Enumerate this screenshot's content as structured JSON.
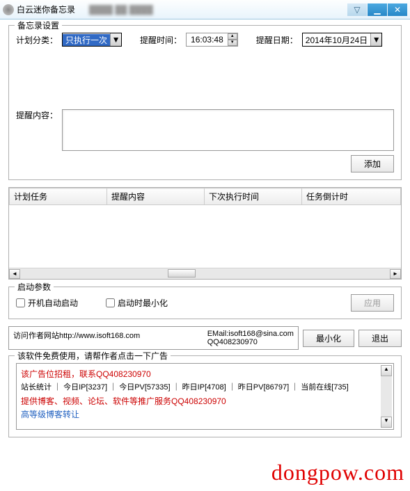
{
  "titlebar": {
    "title": "白云迷你备忘录"
  },
  "settings": {
    "legend": "备忘录设置",
    "plan_type_label": "计划分类：",
    "plan_type_value": "只执行一次",
    "reminder_time_label": "提醒时间：",
    "reminder_time_value": "16:03:48",
    "reminder_date_label": "提醒日期：",
    "reminder_date_value": "2014年10月24日",
    "content_label": "提醒内容：",
    "add_button": "添加"
  },
  "table": {
    "columns": [
      "计划任务",
      "提醒内容",
      "下次执行时间",
      "任务倒计时"
    ]
  },
  "startup": {
    "legend": "启动参数",
    "auto_start": "开机自动启动",
    "minimize_on_start": "启动时最小化",
    "apply": "应用"
  },
  "footer": {
    "link_text": "访问作者网站http://www.isoft168.com",
    "email_line": "EMail:isoft168@sina.com",
    "qq_line": "QQ408230970",
    "minimize": "最小化",
    "exit": "退出"
  },
  "ad": {
    "legend": "该软件免费使用，请帮作者点击一下广告",
    "line1": "该广告位招租，联系QQ408230970",
    "line2": "站长统计 ｜ 今日IP[3237] ｜ 今日PV[57335] ｜ 昨日IP[4708] ｜ 昨日PV[86797] ｜ 当前在线[735]",
    "line3": "提供博客、视频、论坛、软件等推广服务QQ408230970",
    "line4": "高等级博客转让"
  },
  "watermark": "dongpow.com"
}
